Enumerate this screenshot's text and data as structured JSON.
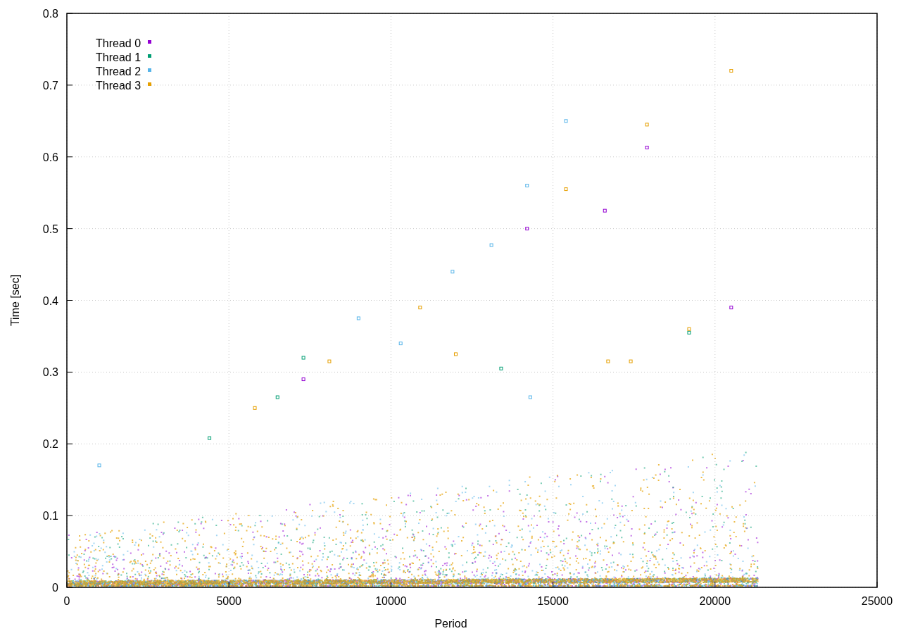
{
  "chart_data": {
    "type": "scatter",
    "xlabel": "Period",
    "ylabel": "Time [sec]",
    "xlim": [
      0,
      25000
    ],
    "ylim": [
      0,
      0.8
    ],
    "xticks": [
      0,
      5000,
      10000,
      15000,
      20000,
      25000
    ],
    "yticks": [
      0,
      0.1,
      0.2,
      0.3,
      0.4,
      0.5,
      0.6,
      0.7,
      0.8
    ],
    "grid": true,
    "legend": "upper left",
    "series": [
      {
        "name": "Thread 0",
        "color": "#9400d3",
        "x": [
          14200,
          16600,
          17900,
          20500,
          7300
        ],
        "values": [
          0.5,
          0.525,
          0.613,
          0.39,
          0.29
        ]
      },
      {
        "name": "Thread 1",
        "color": "#009e73",
        "x": [
          7300,
          6500,
          4400,
          19200,
          13400
        ],
        "values": [
          0.32,
          0.265,
          0.208,
          0.355,
          0.305
        ]
      },
      {
        "name": "Thread 2",
        "color": "#56b4e9",
        "x": [
          15400,
          14200,
          13100,
          11900,
          9000,
          10300,
          14300,
          1000
        ],
        "values": [
          0.65,
          0.56,
          0.477,
          0.44,
          0.375,
          0.34,
          0.265,
          0.17
        ]
      },
      {
        "name": "Thread 3",
        "color": "#e69f00",
        "x": [
          17900,
          15400,
          10900,
          8100,
          12000,
          16700,
          17400,
          19200,
          5800,
          20500
        ],
        "values": [
          0.645,
          0.555,
          0.39,
          0.315,
          0.325,
          0.315,
          0.315,
          0.36,
          0.25,
          0.72
        ]
      }
    ]
  }
}
